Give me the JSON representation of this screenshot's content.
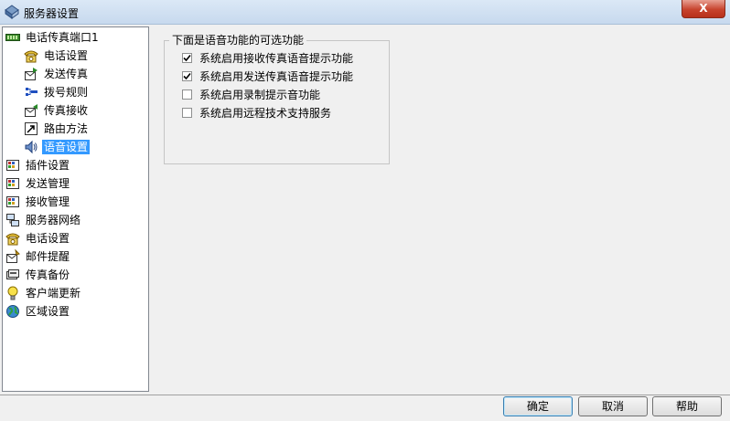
{
  "window": {
    "title": "服务器设置",
    "close_label": "X"
  },
  "tree": [
    {
      "label": "电话传真端口1",
      "icon": "modem-icon"
    },
    {
      "label": "电话设置",
      "icon": "phone-icon"
    },
    {
      "label": "发送传真",
      "icon": "send-fax-icon"
    },
    {
      "label": "拨号规则",
      "icon": "dial-rules-icon"
    },
    {
      "label": "传真接收",
      "icon": "receive-fax-icon"
    },
    {
      "label": "路由方法",
      "icon": "routing-icon"
    },
    {
      "label": "语音设置",
      "icon": "speaker-icon"
    },
    {
      "label": "插件设置",
      "icon": "plugin-icon"
    },
    {
      "label": "发送管理",
      "icon": "send-manage-icon"
    },
    {
      "label": "接收管理",
      "icon": "receive-manage-icon"
    },
    {
      "label": "服务器网络",
      "icon": "network-icon"
    },
    {
      "label": "电话设置",
      "icon": "phone-icon"
    },
    {
      "label": "邮件提醒",
      "icon": "mail-icon"
    },
    {
      "label": "传真备份",
      "icon": "backup-icon"
    },
    {
      "label": "客户端更新",
      "icon": "lightbulb-icon"
    },
    {
      "label": "区域设置",
      "icon": "globe-icon"
    }
  ],
  "group": {
    "title": "下面是语音功能的可选功能",
    "options": [
      {
        "label": "系统启用接收传真语音提示功能",
        "checked": true
      },
      {
        "label": "系统启用发送传真语音提示功能",
        "checked": true
      },
      {
        "label": "系统启用录制提示音功能",
        "checked": false
      },
      {
        "label": "系统启用远程技术支持服务",
        "checked": false
      }
    ]
  },
  "buttons": {
    "ok": "确定",
    "cancel": "取消",
    "help": "帮助"
  },
  "colors": {
    "selection": "#3399ff",
    "close": "#c7432d"
  }
}
